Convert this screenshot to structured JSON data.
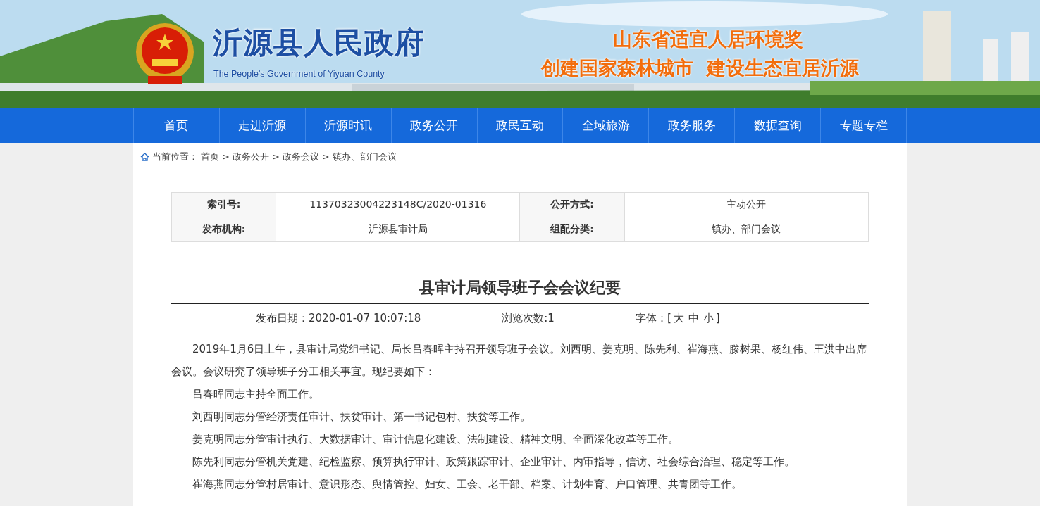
{
  "header": {
    "title": "沂源县人民政府",
    "subtitle": "The People's Government of Yiyuan County",
    "slogans": [
      "山东省适宜人居环境奖",
      "创建国家森林城市  建设生态宜居沂源"
    ]
  },
  "nav": [
    {
      "label": "首页"
    },
    {
      "label": "走进沂源"
    },
    {
      "label": "沂源时讯"
    },
    {
      "label": "政务公开"
    },
    {
      "label": "政民互动"
    },
    {
      "label": "全域旅游"
    },
    {
      "label": "政务服务"
    },
    {
      "label": "数据查询"
    },
    {
      "label": "专题专栏"
    }
  ],
  "breadcrumb": {
    "label": "当前位置：",
    "items": [
      "首页",
      ">",
      "政务公开",
      ">",
      "政务会议",
      ">",
      "镇办、部门会议"
    ]
  },
  "info_table": [
    {
      "label": "索引号:",
      "value": "11370323004223148C/2020-01316",
      "label_2": "公开方式:",
      "value_2": "主动公开"
    },
    {
      "label": "发布机构:",
      "value": "沂源县审计局",
      "label_2": "组配分类:",
      "value_2": "镇办、部门会议"
    }
  ],
  "article": {
    "title": "县审计局领导班子会会议纪要",
    "date": "发布日期：2020-01-07 10:07:18",
    "views": "浏览次数:1",
    "font_label": "字体：[",
    "font_sizes": [
      "大",
      "中",
      "小"
    ],
    "font_close": "]",
    "paragraphs": [
      "2019年1月6日上午，县审计局党组书记、局长吕春晖主持召开领导班子会议。刘西明、姜克明、陈先利、崔海燕、滕树果、杨红伟、王洪中出席会议。会议研究了领导班子分工相关事宜。现纪要如下：",
      "吕春晖同志主持全面工作。",
      "刘西明同志分管经济责任审计、扶贫审计、第一书记包村、扶贫等工作。",
      "姜克明同志分管审计执行、大数据审计、审计信息化建设、法制建设、精神文明、全面深化改革等工作。",
      "陈先利同志分管机关党建、纪检监察、预算执行审计、政策跟踪审计、企业审计、内审指导，信访、社会综合治理、稳定等工作。",
      "崔海燕同志分管村居审计、意识形态、舆情管控、妇女、工会、老干部、档案、计划生育、户口管理、共青团等工作。"
    ]
  }
}
